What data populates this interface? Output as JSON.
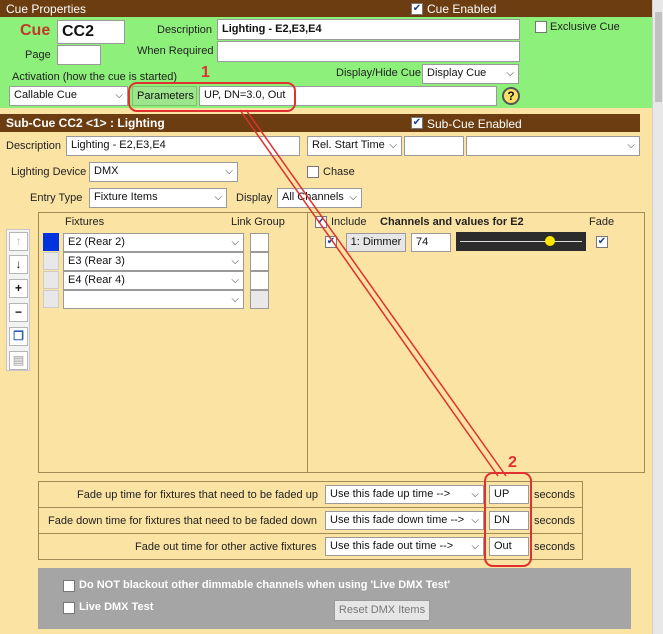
{
  "cue_properties": {
    "header": "Cue Properties",
    "cue_enabled_label": "Cue Enabled",
    "cue_enabled": true,
    "cue_label": "Cue",
    "cue_value": "CC2",
    "page_label": "Page",
    "page_value": "",
    "description_label": "Description",
    "description_value": "Lighting - E2,E3,E4",
    "exclusive_cue_label": "Exclusive Cue",
    "when_required_label": "When Required",
    "when_required_value": "",
    "activation_label": "Activation (how the cue is started)",
    "activation_value": "Callable Cue",
    "display_hide_label": "Display/Hide Cue",
    "display_hide_value": "Display Cue",
    "parameters_label": "Parameters",
    "parameters_value": "UP, DN=3.0, Out",
    "help_icon_text": "?"
  },
  "sub_cue": {
    "header": "Sub-Cue CC2 <1> : Lighting",
    "enabled_label": "Sub-Cue Enabled",
    "description_label": "Description",
    "description_value": "Lighting - E2,E3,E4",
    "rel_start_value": "Rel. Start Time",
    "lighting_device_label": "Lighting Device",
    "lighting_device_value": "DMX",
    "chase_label": "Chase",
    "entry_type_label": "Entry Type",
    "entry_type_value": "Fixture Items",
    "display_label": "Display",
    "display_value": "All Channels",
    "fixtures_header": "Fixtures",
    "link_group_header": "Link Group",
    "include_label": "Include",
    "channels_header": "Channels and values for E2",
    "fade_header": "Fade",
    "fixtures": [
      "E2 (Rear 2)",
      "E3 (Rear 3)",
      "E4 (Rear 4)",
      ""
    ],
    "channel": {
      "name": "1: Dimmer",
      "value": "74",
      "level": 0.74
    },
    "fade_rows": [
      {
        "label": "Fade up time for fixtures that need to be faded up",
        "select": "Use this fade up time -->",
        "value": "UP",
        "unit": "seconds"
      },
      {
        "label": "Fade down time for fixtures that need to be faded down",
        "select": "Use this fade down time -->",
        "value": "DN",
        "unit": "seconds"
      },
      {
        "label": "Fade out time for other active fixtures",
        "select": "Use this fade out time -->",
        "value": "Out",
        "unit": "seconds"
      }
    ],
    "no_blackout_label": "Do NOT blackout other dimmable channels when using 'Live DMX Test'",
    "live_dmx_label": "Live DMX Test",
    "reset_dmx_label": "Reset DMX Items"
  },
  "annotations": {
    "one": "1",
    "two": "2"
  },
  "colors": {
    "header_brown": "#6b3d10",
    "cue_green": "#8df07a",
    "panel_tan": "#fbe3a3",
    "annotation_red": "#e03030"
  }
}
